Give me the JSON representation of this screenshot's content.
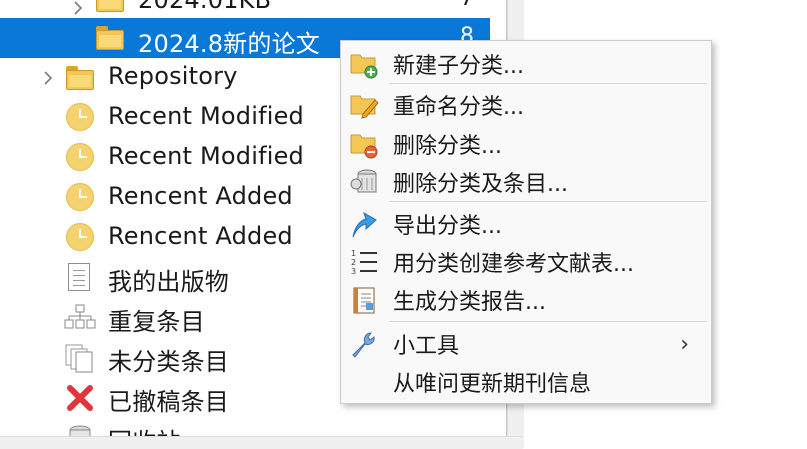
{
  "tree": {
    "items": [
      {
        "label": "2024.01KB",
        "count": "7",
        "icon": "folder-icon",
        "expander": "chevron-right-icon",
        "selected": false
      },
      {
        "label": "2024.8新的论文",
        "count": "8",
        "icon": "folder-icon",
        "selected": true
      },
      {
        "label": "Repository",
        "icon": "folder-icon",
        "expander": "chevron-right-icon"
      },
      {
        "label": "Recent Modified",
        "icon": "clock-icon"
      },
      {
        "label": "Recent Modified",
        "icon": "clock-icon"
      },
      {
        "label": "Rencent Added",
        "icon": "clock-icon"
      },
      {
        "label": "Rencent Added",
        "icon": "clock-icon"
      },
      {
        "label": "我的出版物",
        "icon": "document-icon"
      },
      {
        "label": "重复条目",
        "icon": "duplicate-tree-icon"
      },
      {
        "label": "未分类条目",
        "icon": "unfiled-items-icon"
      },
      {
        "label": "已撤稿条目",
        "icon": "retracted-x-icon"
      },
      {
        "label": "回收站",
        "icon": "trash-icon"
      }
    ],
    "chevron_glyph": "›"
  },
  "context_menu": {
    "items": [
      {
        "label": "新建子分类...",
        "icon": "new-subcollection-icon"
      },
      {
        "label": "重命名分类...",
        "icon": "rename-collection-icon"
      },
      {
        "label": "删除分类...",
        "icon": "delete-collection-icon"
      },
      {
        "label": "删除分类及条目...",
        "icon": "delete-collection-and-items-icon"
      },
      {
        "label": "导出分类...",
        "icon": "export-arrow-icon"
      },
      {
        "label": "用分类创建参考文献表...",
        "icon": "bibliography-list-icon"
      },
      {
        "label": "生成分类报告...",
        "icon": "report-icon"
      },
      {
        "label": "小工具",
        "icon": "wrench-icon",
        "submenu_arrow": "›"
      },
      {
        "label": "从唯问更新期刊信息",
        "icon": ""
      }
    ]
  },
  "colors": {
    "selection": "#0a78d7",
    "folder": "#f3c755",
    "clock": "#f5d371",
    "retracted": "#e0353a"
  }
}
